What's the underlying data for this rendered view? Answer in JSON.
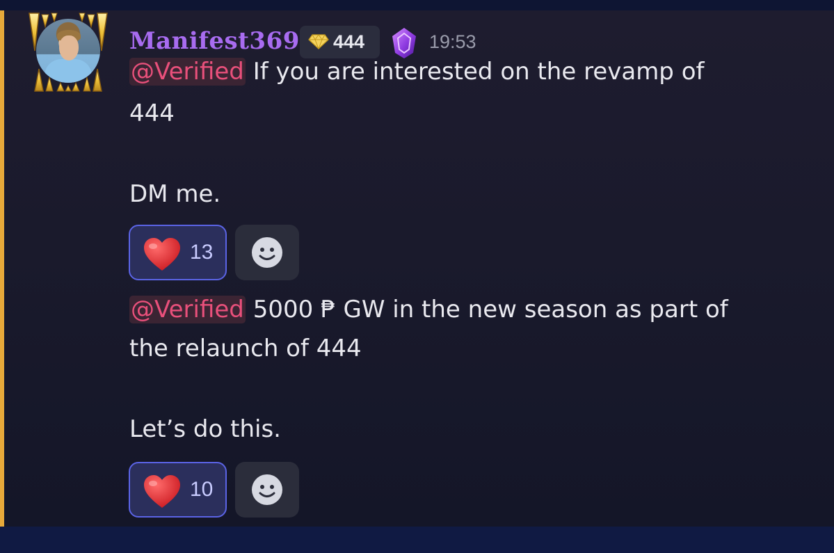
{
  "message": {
    "username": "Manifest369",
    "tag_text": "444",
    "timestamp": "19:53",
    "icons": {
      "avatar": "player-avatar",
      "avatar_decoration": "golden-fangs-icon",
      "tag_badge": "diamond-icon",
      "boost": "purple-crystal-icon"
    },
    "colors": {
      "username": "#a86cf0",
      "mention": "#e9507b",
      "highlight_bar": "#e7a93a",
      "reaction_border": "#5b64e6"
    }
  },
  "posts": [
    {
      "mention": "@Verified",
      "line1": " If you are interested on the revamp of",
      "line2": "444",
      "line3": "DM me.",
      "reaction": {
        "emoji": "red-heart",
        "count": "13"
      }
    },
    {
      "mention": "@Verified",
      "line1": " 5000 ₱ GW in the new season as part of",
      "line2": "the relaunch of 444",
      "line3": "Let’s do this.",
      "reaction": {
        "emoji": "red-heart",
        "count": "10"
      }
    }
  ]
}
